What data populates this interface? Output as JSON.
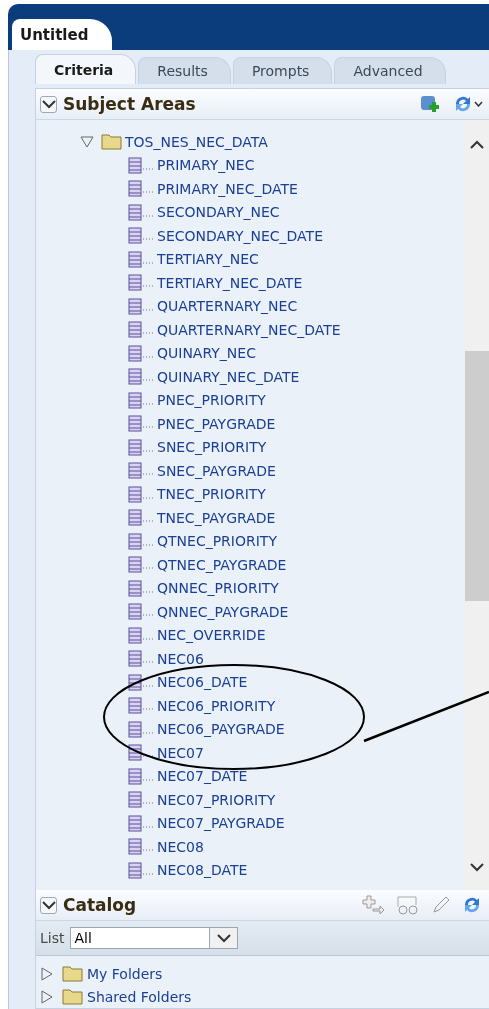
{
  "document_tab": {
    "title": "Untitled"
  },
  "tabs": [
    {
      "label": "Criteria",
      "selected": true
    },
    {
      "label": "Results",
      "selected": false
    },
    {
      "label": "Prompts",
      "selected": false
    },
    {
      "label": "Advanced",
      "selected": false
    }
  ],
  "subject_areas": {
    "title": "Subject Areas",
    "expanded": true,
    "tree": [
      {
        "label": "TOS_NES_NEC_DATA",
        "expanded": true,
        "children": [
          {
            "label": "PRIMARY_NEC"
          },
          {
            "label": "PRIMARY_NEC_DATE"
          },
          {
            "label": "SECONDARY_NEC"
          },
          {
            "label": "SECONDARY_NEC_DATE"
          },
          {
            "label": "TERTIARY_NEC"
          },
          {
            "label": "TERTIARY_NEC_DATE"
          },
          {
            "label": "QUARTERNARY_NEC"
          },
          {
            "label": "QUARTERNARY_NEC_DATE"
          },
          {
            "label": "QUINARY_NEC"
          },
          {
            "label": "QUINARY_NEC_DATE"
          },
          {
            "label": "PNEC_PRIORITY"
          },
          {
            "label": "PNEC_PAYGRADE"
          },
          {
            "label": "SNEC_PRIORITY"
          },
          {
            "label": "SNEC_PAYGRADE"
          },
          {
            "label": "TNEC_PRIORITY"
          },
          {
            "label": "TNEC_PAYGRADE"
          },
          {
            "label": "QTNEC_PRIORITY"
          },
          {
            "label": "QTNEC_PAYGRADE"
          },
          {
            "label": "QNNEC_PRIORITY"
          },
          {
            "label": "QNNEC_PAYGRADE"
          },
          {
            "label": "NEC_OVERRIDE"
          },
          {
            "label": "NEC06"
          },
          {
            "label": "NEC06_DATE"
          },
          {
            "label": "NEC06_PRIORITY"
          },
          {
            "label": "NEC06_PAYGRADE"
          },
          {
            "label": "NEC07"
          },
          {
            "label": "NEC07_DATE"
          },
          {
            "label": "NEC07_PRIORITY"
          },
          {
            "label": "NEC07_PAYGRADE"
          },
          {
            "label": "NEC08"
          },
          {
            "label": "NEC08_DATE"
          }
        ]
      }
    ]
  },
  "catalog": {
    "title": "Catalog",
    "expanded": true,
    "list_label": "List",
    "list_value": "All",
    "folders": [
      {
        "label": "My Folders",
        "expanded": false
      },
      {
        "label": "Shared Folders",
        "expanded": false
      }
    ]
  }
}
